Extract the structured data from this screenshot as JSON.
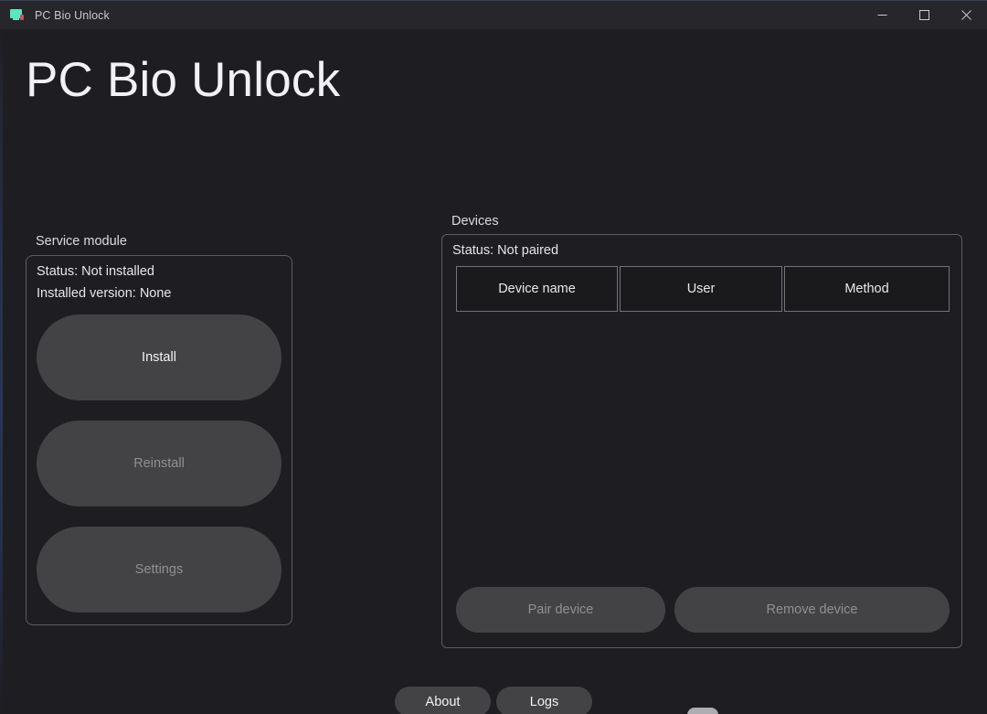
{
  "window": {
    "title": "PC Bio Unlock",
    "icon": "monitor-icon",
    "controls": {
      "minimize": "minimize-icon",
      "maximize": "maximize-icon",
      "close": "close-icon"
    }
  },
  "app": {
    "heading": "PC Bio Unlock"
  },
  "service_module": {
    "caption": "Service module",
    "status": "Status: Not installed",
    "installed_version": "Installed version: None",
    "buttons": [
      {
        "label": "Install",
        "enabled": true
      },
      {
        "label": "Reinstall",
        "enabled": false
      },
      {
        "label": "Settings",
        "enabled": false
      }
    ]
  },
  "devices": {
    "caption": "Devices",
    "status": "Status: Not paired",
    "columns": [
      "Device name",
      "User",
      "Method"
    ],
    "rows": [],
    "buttons": [
      {
        "label": "Pair device",
        "enabled": false
      },
      {
        "label": "Remove device",
        "enabled": false
      }
    ]
  },
  "bottom_bar": {
    "buttons": [
      {
        "label": "About",
        "enabled": true
      },
      {
        "label": "Logs",
        "enabled": true
      }
    ]
  },
  "colors": {
    "background": "#1e1d22",
    "titlebar": "#26262b",
    "panel_border": "#5c5c62",
    "button_fill": "#434345",
    "text_primary": "#f2f2f4",
    "text_disabled": "#8f8f95",
    "accent_icon": "#5fe3c0"
  }
}
